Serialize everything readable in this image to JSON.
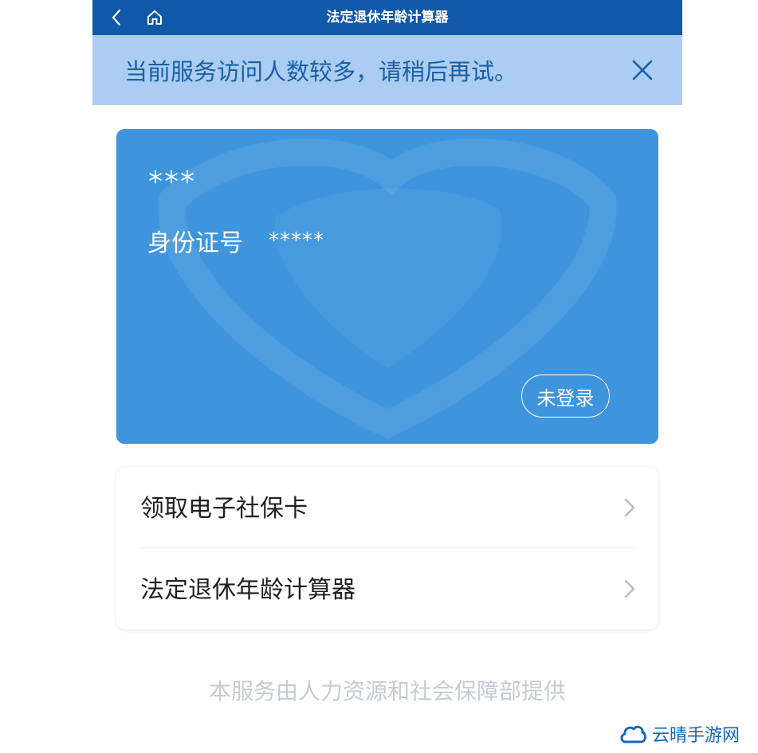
{
  "header": {
    "title": "法定退休年龄计算器",
    "back_icon": "chevron-left-icon",
    "home_icon": "home-icon",
    "bg_color": "#1059a8"
  },
  "notice": {
    "text": "当前服务访问人数较多，请稍后再试。",
    "close_icon": "close-icon",
    "bg_color": "#abcdf2",
    "text_color": "#1a5fa6"
  },
  "card": {
    "name": "***",
    "id_label": "身份证号",
    "id_value": "*****",
    "login_button": "未登录",
    "bg_color": "#3f95dd"
  },
  "menu": {
    "items": [
      {
        "label": "领取电子社保卡",
        "icon": "chevron-right-icon"
      },
      {
        "label": "法定退休年龄计算器",
        "icon": "chevron-right-icon"
      }
    ]
  },
  "footer": {
    "text": "本服务由人力资源和社会保障部提供"
  },
  "watermark": {
    "text": "云晴手游网",
    "icon": "cloud-icon"
  }
}
